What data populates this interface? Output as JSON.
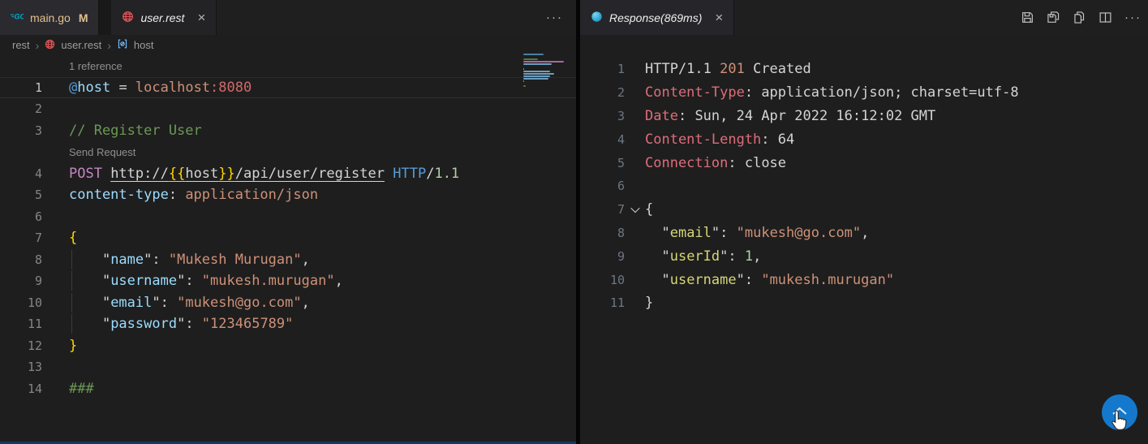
{
  "left_pane": {
    "tabs": [
      {
        "label": "main.go",
        "modified_badge": "M"
      },
      {
        "label": "user.rest",
        "close_glyph": "×"
      }
    ],
    "more_actions_glyph": "···",
    "breadcrumb": {
      "separator": "›",
      "items": [
        "rest",
        "user.rest",
        "host"
      ]
    },
    "editor": {
      "lines": [
        {
          "lens": "1 reference"
        },
        {
          "n": 1,
          "active": true,
          "tk": [
            [
              "@",
              "blue"
            ],
            [
              "host",
              "key"
            ],
            [
              " = ",
              "d"
            ],
            [
              "localhost",
              "str"
            ],
            [
              ":8080",
              "red"
            ]
          ]
        },
        {
          "n": 2,
          "tk": []
        },
        {
          "n": 3,
          "tk": [
            [
              "// Register User",
              "cmt"
            ]
          ]
        },
        {
          "lens": "Send Request",
          "link": true
        },
        {
          "n": 4,
          "tk": [
            [
              "POST ",
              "kw"
            ],
            [
              "http://",
              "d",
              "u"
            ],
            [
              "{{",
              "y",
              "u"
            ],
            [
              "host",
              "d",
              "u"
            ],
            [
              "}}",
              "y",
              "u"
            ],
            [
              "/api/user/register",
              "d",
              "u"
            ],
            [
              " ",
              "d"
            ],
            [
              "HTTP",
              "blue"
            ],
            [
              "/",
              "d"
            ],
            [
              "1.1",
              "num"
            ]
          ]
        },
        {
          "n": 5,
          "tk": [
            [
              "content-type",
              "key"
            ],
            [
              ": ",
              "d"
            ],
            [
              "application/json",
              "str"
            ]
          ]
        },
        {
          "n": 6,
          "tk": []
        },
        {
          "n": 7,
          "tk": [
            [
              "{",
              "y"
            ]
          ]
        },
        {
          "n": 8,
          "g": 1,
          "tk": [
            [
              "    \"",
              "d"
            ],
            [
              "name",
              "key"
            ],
            [
              "\": ",
              "d"
            ],
            [
              "\"Mukesh Murugan\"",
              "str"
            ],
            [
              ",",
              "d"
            ]
          ]
        },
        {
          "n": 9,
          "g": 1,
          "tk": [
            [
              "    \"",
              "d"
            ],
            [
              "username",
              "key"
            ],
            [
              "\": ",
              "d"
            ],
            [
              "\"mukesh.murugan\"",
              "str"
            ],
            [
              ",",
              "d"
            ]
          ]
        },
        {
          "n": 10,
          "g": 1,
          "tk": [
            [
              "    \"",
              "d"
            ],
            [
              "email",
              "key"
            ],
            [
              "\": ",
              "d"
            ],
            [
              "\"mukesh@go.com\"",
              "str"
            ],
            [
              ",",
              "d"
            ]
          ]
        },
        {
          "n": 11,
          "g": 1,
          "tk": [
            [
              "    \"",
              "d"
            ],
            [
              "password",
              "key"
            ],
            [
              "\": ",
              "d"
            ],
            [
              "\"123465789\"",
              "str"
            ]
          ]
        },
        {
          "n": 12,
          "tk": [
            [
              "}",
              "y"
            ]
          ]
        },
        {
          "n": 13,
          "tk": []
        },
        {
          "n": 14,
          "tk": [
            [
              "###",
              "cmt"
            ]
          ]
        }
      ]
    }
  },
  "right_pane": {
    "tab": {
      "label": "Response(869ms)",
      "close_glyph": "×"
    },
    "more_actions_glyph": "···",
    "editor": {
      "lines": [
        {
          "n": 1,
          "tk": [
            [
              "HTTP/1.1 ",
              "d"
            ],
            [
              "201",
              "str"
            ],
            [
              " Created",
              "d"
            ]
          ]
        },
        {
          "n": 2,
          "tk": [
            [
              "Content-Type",
              "pink"
            ],
            [
              ": ",
              "d"
            ],
            [
              "application/json; charset=utf-8",
              "d"
            ]
          ]
        },
        {
          "n": 3,
          "tk": [
            [
              "Date",
              "pink"
            ],
            [
              ": ",
              "d"
            ],
            [
              "Sun, 24 Apr 2022 16:12:02 GMT",
              "d"
            ]
          ]
        },
        {
          "n": 4,
          "tk": [
            [
              "Content-Length",
              "pink"
            ],
            [
              ": ",
              "d"
            ],
            [
              "64",
              "d"
            ]
          ]
        },
        {
          "n": 5,
          "tk": [
            [
              "Connection",
              "pink"
            ],
            [
              ": ",
              "d"
            ],
            [
              "close",
              "d"
            ]
          ]
        },
        {
          "n": 6,
          "tk": []
        },
        {
          "n": 7,
          "fold": true,
          "tk": [
            [
              "{",
              "d"
            ]
          ]
        },
        {
          "n": 8,
          "tk": [
            [
              "  \"",
              "d"
            ],
            [
              "email",
              "rkey"
            ],
            [
              "\": ",
              "d"
            ],
            [
              "\"mukesh@go.com\"",
              "str"
            ],
            [
              ",",
              "d"
            ]
          ]
        },
        {
          "n": 9,
          "tk": [
            [
              "  \"",
              "d"
            ],
            [
              "userId",
              "rkey"
            ],
            [
              "\": ",
              "d"
            ],
            [
              "1",
              "num"
            ],
            [
              ",",
              "d"
            ]
          ]
        },
        {
          "n": 10,
          "tk": [
            [
              "  \"",
              "d"
            ],
            [
              "username",
              "rkey"
            ],
            [
              "\": ",
              "d"
            ],
            [
              "\"mukesh.murugan\"",
              "str"
            ]
          ]
        },
        {
          "n": 11,
          "tk": [
            [
              "}",
              "d"
            ]
          ]
        }
      ]
    }
  },
  "colors": {
    "editor_bg": "#1e1e1e",
    "accent_blue": "#1479cd",
    "modified_yellow": "#e2c08d",
    "comment_green": "#6a9955",
    "string_orange": "#ce9178",
    "key_blue": "#9cdcfe",
    "header_pink": "#de6d7a",
    "keyword_magenta": "#c586c0",
    "number_green": "#b5cea8",
    "brace_yellow": "#ffd700",
    "response_key_yellow": "#d5d578",
    "go_cyan": "#00acd7",
    "rest_red": "#e25555"
  }
}
